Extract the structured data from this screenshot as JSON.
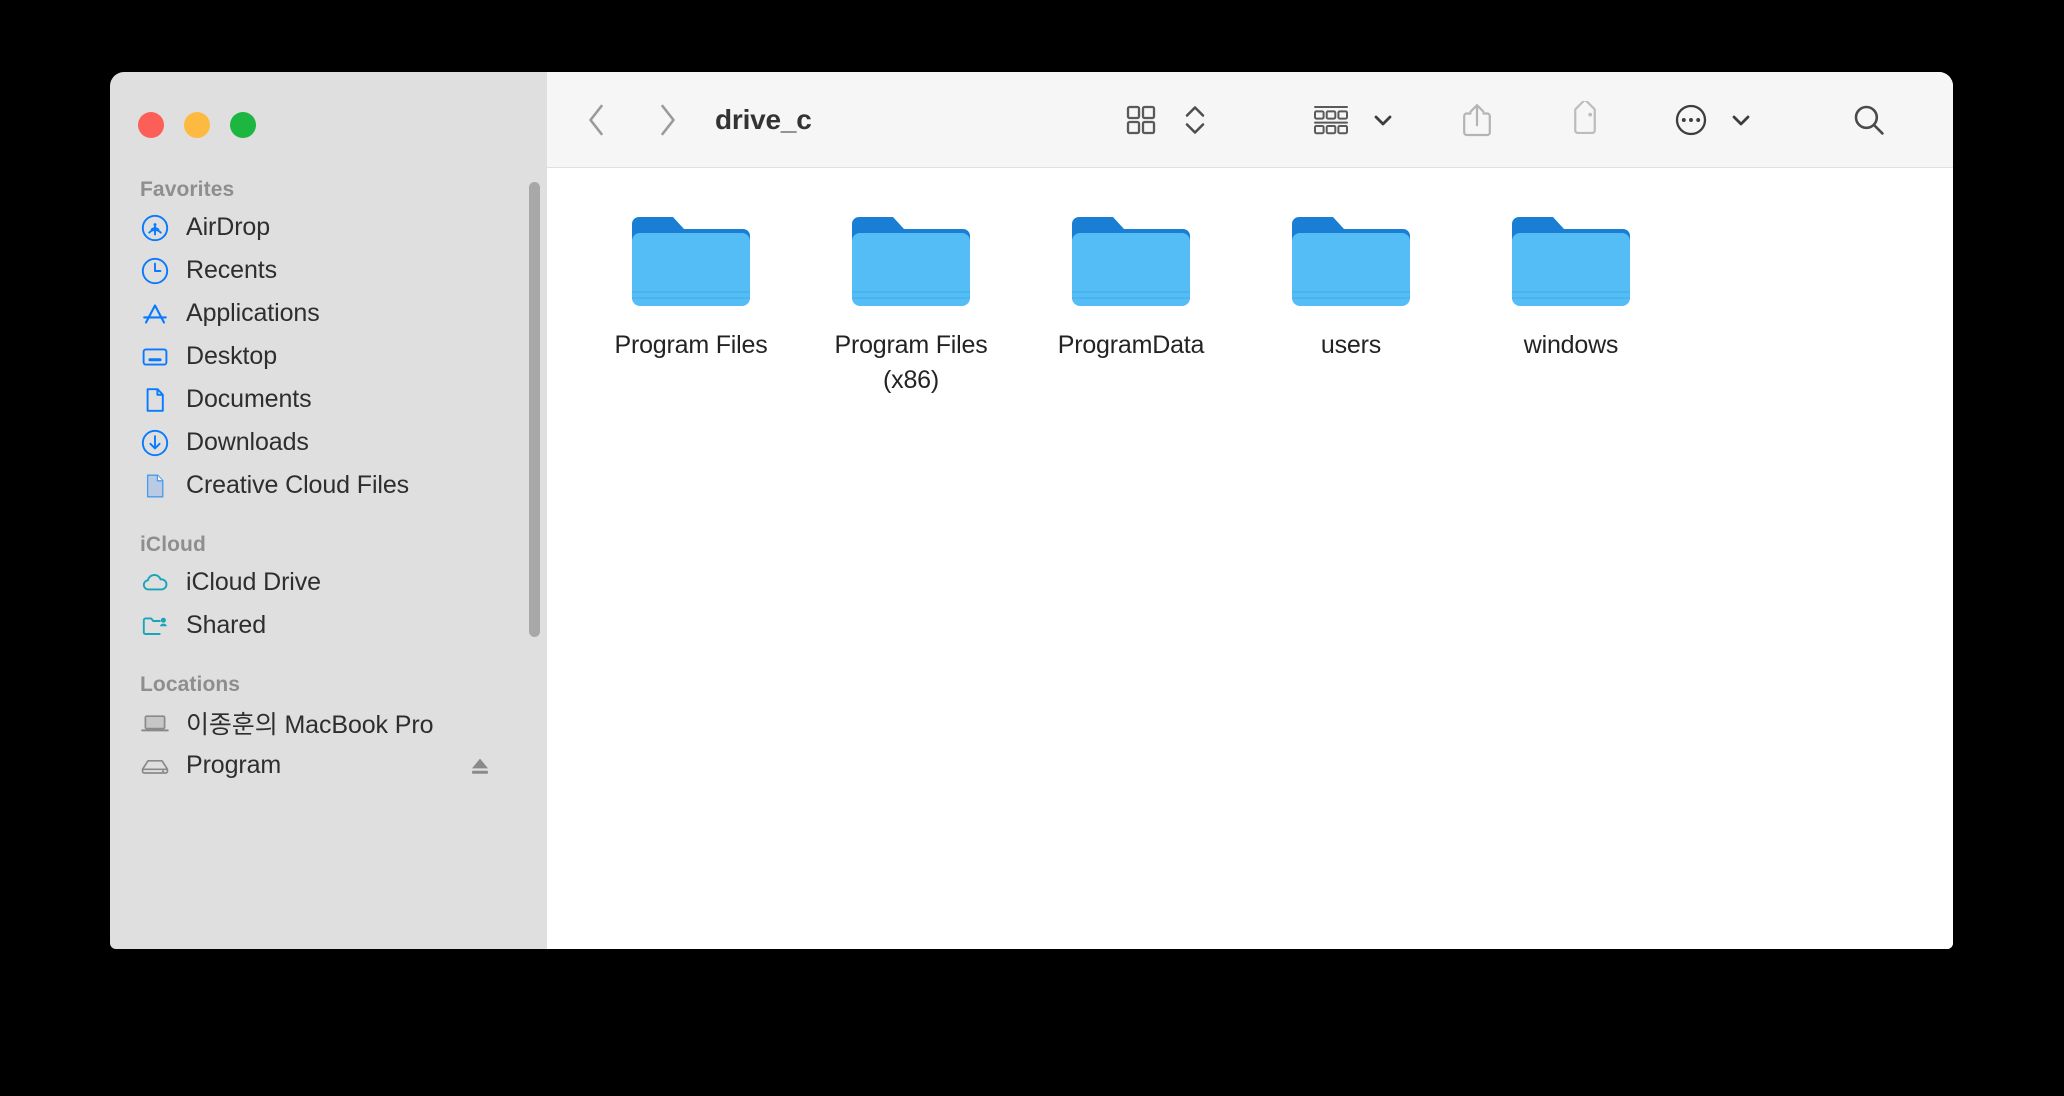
{
  "window": {
    "traffic_lights": [
      {
        "name": "close",
        "color": "#fc5f57"
      },
      {
        "name": "minimize",
        "color": "#fcbb40"
      },
      {
        "name": "maximize",
        "color": "#1db641"
      }
    ]
  },
  "toolbar": {
    "back_label": "Back",
    "forward_label": "Forward",
    "title": "drive_c",
    "view_mode_label": "Icon View",
    "view_stepper_label": "Change View",
    "group_by_label": "Group Items",
    "share_label": "Share",
    "tags_label": "Tags",
    "more_label": "More Actions",
    "search_label": "Search"
  },
  "sidebar": {
    "groups": [
      {
        "title": "Favorites",
        "items": [
          {
            "label": "AirDrop",
            "icon": "airdrop-icon",
            "color": "#087aff"
          },
          {
            "label": "Recents",
            "icon": "clock-icon",
            "color": "#087aff"
          },
          {
            "label": "Applications",
            "icon": "applications-icon",
            "color": "#087aff"
          },
          {
            "label": "Desktop",
            "icon": "desktop-icon",
            "color": "#087aff"
          },
          {
            "label": "Documents",
            "icon": "document-icon",
            "color": "#087aff"
          },
          {
            "label": "Downloads",
            "icon": "downloads-icon",
            "color": "#087aff"
          },
          {
            "label": "Creative Cloud Files",
            "icon": "document-filled-icon",
            "color": "#b9cbe4"
          }
        ]
      },
      {
        "title": "iCloud",
        "items": [
          {
            "label": "iCloud Drive",
            "icon": "cloud-icon",
            "color": "#18a5ba"
          },
          {
            "label": "Shared",
            "icon": "shared-folder-icon",
            "color": "#18a5ba"
          }
        ]
      },
      {
        "title": "Locations",
        "items": [
          {
            "label": "이종훈의 MacBook Pro",
            "icon": "laptop-icon",
            "color": "#8a8a8a"
          },
          {
            "label": "Program",
            "icon": "harddisk-icon",
            "color": "#8a8a8a",
            "trailing_icon": "eject-icon"
          }
        ]
      }
    ]
  },
  "content": {
    "items": [
      {
        "label": "Program Files",
        "icon": "folder-icon"
      },
      {
        "label": "Program Files (x86)",
        "icon": "folder-icon"
      },
      {
        "label": "ProgramData",
        "icon": "folder-icon"
      },
      {
        "label": "users",
        "icon": "folder-icon"
      },
      {
        "label": "windows",
        "icon": "folder-icon"
      }
    ]
  },
  "colors": {
    "folder_top": "#1a7fd4",
    "folder_body": "#54bdf5",
    "sidebar_bg": "#dfdfdf",
    "toolbar_bg": "#f6f6f6",
    "accent": "#087aff"
  }
}
